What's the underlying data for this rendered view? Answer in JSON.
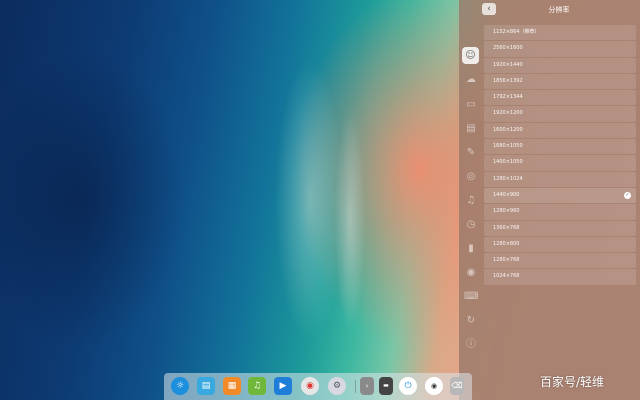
{
  "panel": {
    "back_label": "‹",
    "title": "分辨率",
    "nav_icons": [
      "account-icon",
      "cloud-sync-icon",
      "display-icon",
      "default-apps-icon",
      "personalization-icon",
      "network-icon",
      "sound-icon",
      "datetime-icon",
      "power-icon",
      "mouse-icon",
      "keyboard-icon",
      "update-icon",
      "system-info-icon"
    ],
    "resolutions": [
      "1152×864（推荐）",
      "2560×1600",
      "1920×1440",
      "1856×1392",
      "1792×1344",
      "1920×1200",
      "1600×1200",
      "1680×1050",
      "1400×1050",
      "1280×1024",
      "1440×900",
      "1280×960",
      "1360×768",
      "1280×800",
      "1280×768",
      "1024×768"
    ],
    "selected_resolution": "1440×900"
  },
  "dock": {
    "icons": [
      "launcher-icon",
      "file-manager-icon",
      "app-store-icon",
      "music-icon",
      "video-icon",
      "chrome-icon",
      "settings-icon",
      "terminal-icon",
      "screen-icon",
      "power-button-icon",
      "app-badge-icon",
      "trash-icon"
    ]
  },
  "watermark": "百家号/轻维",
  "colors": {
    "panel_bg": "#96786a",
    "accent": "#ffffff"
  }
}
